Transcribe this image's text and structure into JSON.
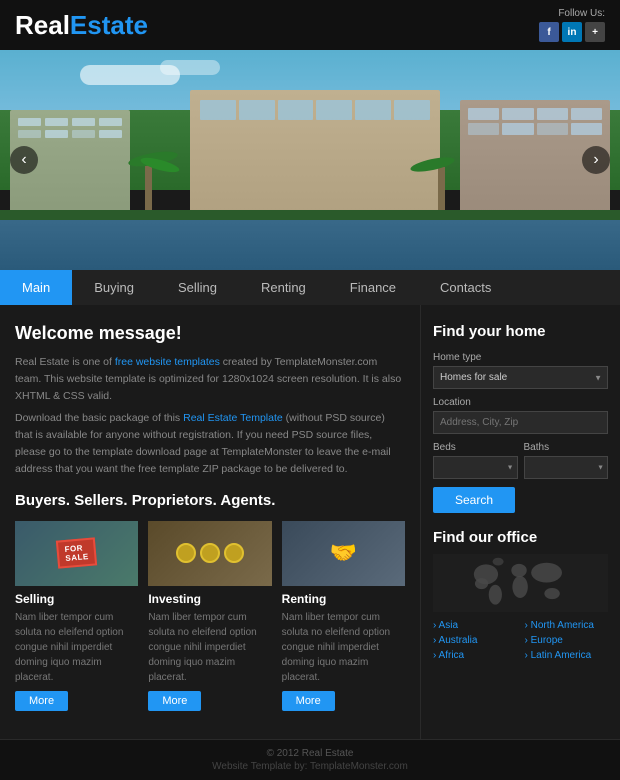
{
  "header": {
    "logo_real": "Real",
    "logo_estate": "Estate",
    "follow_label": "Follow Us:",
    "social": [
      "f",
      "in",
      "+"
    ]
  },
  "nav": {
    "items": [
      {
        "label": "Main",
        "active": true
      },
      {
        "label": "Buying",
        "active": false
      },
      {
        "label": "Selling",
        "active": false
      },
      {
        "label": "Renting",
        "active": false
      },
      {
        "label": "Finance",
        "active": false
      },
      {
        "label": "Contacts",
        "active": false
      }
    ]
  },
  "hero": {
    "arrow_left": "‹",
    "arrow_right": "›"
  },
  "main": {
    "welcome_title": "Welcome message!",
    "welcome_p1": "Real Estate is one of free website templates created by TemplateMonster.com team. This website template is optimized for 1280x1024 screen resolution. It is also XHTML & CSS valid.",
    "welcome_p2": "Download the basic package of this Real Estate Template (without PSD source) that is available for anyone without registration. If you need PSD source files, please go to the template download page at TemplateMonster to leave the e-mail address that you want the free template ZIP package to be delivered to.",
    "section_title": "Buyers. Sellers. Proprietors. Agents.",
    "cards": [
      {
        "id": "selling",
        "img_label": "FOR SALE",
        "title": "Selling",
        "text": "Nam liber tempor cum soluta no eleifend option congue nihil imperdiet doming iquo mazim placerat.",
        "btn": "More"
      },
      {
        "id": "investing",
        "img_label": "",
        "title": "Investing",
        "text": "Nam liber tempor cum soluta no eleifend option congue nihil imperdiet doming iquo mazim placerat.",
        "btn": "More"
      },
      {
        "id": "renting",
        "img_label": "",
        "title": "Renting",
        "text": "Nam liber tempor cum soluta no eleifend option congue nihil imperdiet doming iquo mazim placerat.",
        "btn": "More"
      }
    ]
  },
  "sidebar": {
    "find_title": "Find your home",
    "home_type_label": "Home type",
    "home_type_value": "Homes for sale",
    "location_label": "Location",
    "location_placeholder": "Address, City, Zip",
    "beds_label": "Beds",
    "baths_label": "Baths",
    "search_btn": "Search",
    "office_title": "Find our office",
    "regions": {
      "left": [
        "Asia",
        "Australia",
        "Africa"
      ],
      "right": [
        "North America",
        "Europe",
        "Latin America"
      ]
    }
  },
  "footer": {
    "copyright": "© 2012 Real Estate",
    "template_by": "Website Template by: TemplateMonster.com"
  }
}
